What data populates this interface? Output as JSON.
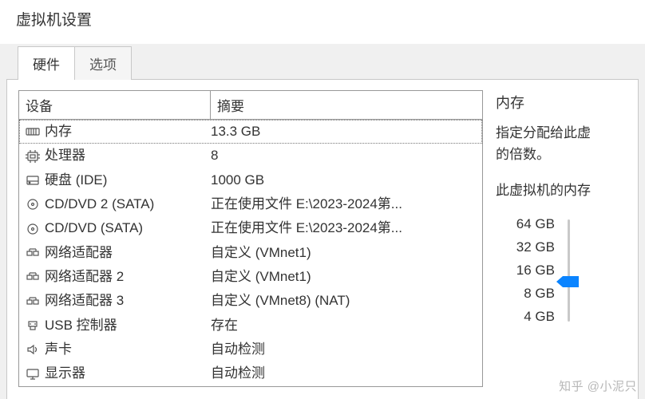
{
  "window_title": "虚拟机设置",
  "tabs": {
    "hardware": "硬件",
    "options": "选项"
  },
  "headers": {
    "device": "设备",
    "summary": "摘要"
  },
  "devices": [
    {
      "icon": "memory",
      "label": "内存",
      "summary": "13.3 GB",
      "selected": true
    },
    {
      "icon": "cpu",
      "label": "处理器",
      "summary": "8"
    },
    {
      "icon": "disk",
      "label": "硬盘 (IDE)",
      "summary": "1000 GB"
    },
    {
      "icon": "cd",
      "label": "CD/DVD 2 (SATA)",
      "summary": "正在使用文件 E:\\2023-2024第..."
    },
    {
      "icon": "cd",
      "label": "CD/DVD (SATA)",
      "summary": "正在使用文件 E:\\2023-2024第..."
    },
    {
      "icon": "net",
      "label": "网络适配器",
      "summary": "自定义 (VMnet1)"
    },
    {
      "icon": "net",
      "label": "网络适配器 2",
      "summary": "自定义 (VMnet1)"
    },
    {
      "icon": "net",
      "label": "网络适配器 3",
      "summary": "自定义 (VMnet8) (NAT)"
    },
    {
      "icon": "usb",
      "label": "USB 控制器",
      "summary": "存在"
    },
    {
      "icon": "sound",
      "label": "声卡",
      "summary": "自动检测"
    },
    {
      "icon": "display",
      "label": "显示器",
      "summary": "自动检测"
    }
  ],
  "mem_panel": {
    "title": "内存",
    "desc_line1": "指定分配给此虚",
    "desc_line2": "的倍数。",
    "current_label": "此虚拟机的内存",
    "ticks": [
      "64 GB",
      "32 GB",
      "16 GB",
      "8 GB",
      "4 GB"
    ]
  },
  "watermark": "知乎 @小泥只"
}
